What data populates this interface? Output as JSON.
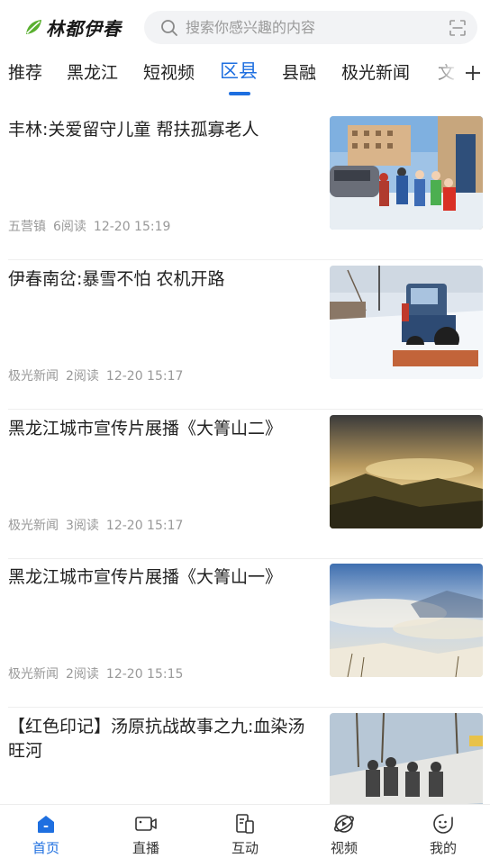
{
  "header": {
    "logo_text": "林都伊春",
    "search_placeholder": "搜索你感兴趣的内容"
  },
  "tabs": [
    {
      "label": "推荐",
      "active": false
    },
    {
      "label": "黑龙江",
      "active": false
    },
    {
      "label": "短视频",
      "active": false
    },
    {
      "label": "区县",
      "active": true
    },
    {
      "label": "县融",
      "active": false
    },
    {
      "label": "极光新闻",
      "active": false
    },
    {
      "label": "文",
      "active": false
    }
  ],
  "news": [
    {
      "title": "丰林:关爱留守儿童 帮扶孤寡老人",
      "source": "五营镇",
      "reads": "6阅读",
      "time": "12-20 15:19"
    },
    {
      "title": "伊春南岔:暴雪不怕 农机开路",
      "source": "极光新闻",
      "reads": "2阅读",
      "time": "12-20 15:17"
    },
    {
      "title": "黑龙江城市宣传片展播《大箐山二》",
      "source": "极光新闻",
      "reads": "3阅读",
      "time": "12-20 15:17"
    },
    {
      "title": "黑龙江城市宣传片展播《大箐山一》",
      "source": "极光新闻",
      "reads": "2阅读",
      "time": "12-20 15:15"
    },
    {
      "title": "【红色印记】汤原抗战故事之九:血染汤旺河",
      "source": "",
      "reads": "",
      "time": ""
    }
  ],
  "bottom_nav": [
    {
      "label": "首页",
      "icon": "home-icon",
      "active": true
    },
    {
      "label": "直播",
      "icon": "live-camera-icon",
      "active": false
    },
    {
      "label": "互动",
      "icon": "interact-icon",
      "active": false
    },
    {
      "label": "视频",
      "icon": "video-icon",
      "active": false
    },
    {
      "label": "我的",
      "icon": "profile-icon",
      "active": false
    }
  ],
  "colors": {
    "accent": "#1e6fe0",
    "logo_green": "#5ab030"
  }
}
